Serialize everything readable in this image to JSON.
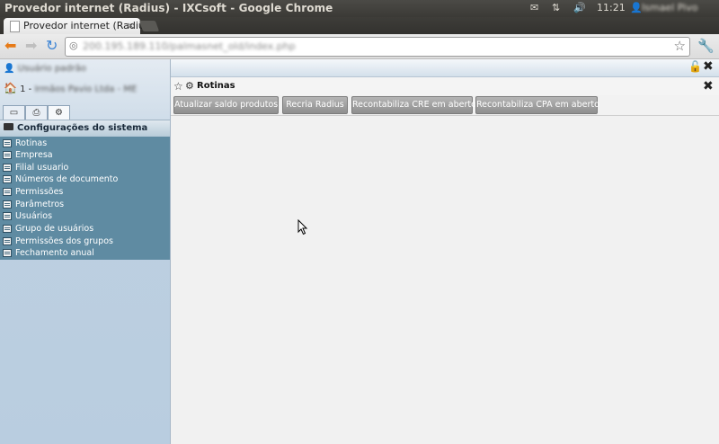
{
  "os": {
    "window_title": "Provedor internet (Radius) - IXCsoft - Google Chrome",
    "clock": "11:21",
    "user": "Ismael Pivo"
  },
  "browser": {
    "tab_title": "Provedor internet (Radius",
    "tab_close": "×",
    "url": "200.195.189.110/palmasnet_old/index.php"
  },
  "sidebar": {
    "user_name": "Usuário padrão",
    "org_prefix": "1 - ",
    "org_name": "Irmãos Pavio Ltda - ME",
    "section_title": "Configurações do sistema",
    "items": [
      {
        "label": "Rotinas"
      },
      {
        "label": "Empresa"
      },
      {
        "label": "Filial usuario"
      },
      {
        "label": "Números de documento"
      },
      {
        "label": "Permissões"
      },
      {
        "label": "Parâmetros"
      },
      {
        "label": "Usuários"
      },
      {
        "label": "Grupo de usuários"
      },
      {
        "label": "Permissões dos grupos"
      },
      {
        "label": "Fechamento anual"
      }
    ]
  },
  "window": {
    "title": "Rotinas",
    "buttons": [
      {
        "label": "Atualizar saldo produtos"
      },
      {
        "label": "Recria Radius"
      },
      {
        "label": "Recontabiliza CRE em aberto"
      },
      {
        "label": "Recontabiliza CPA em aberto"
      }
    ]
  },
  "colors": {
    "menu_bg": "#5f8ba2",
    "panel_bg": "#b9cde0",
    "button_bg": "#9e9e9e"
  }
}
